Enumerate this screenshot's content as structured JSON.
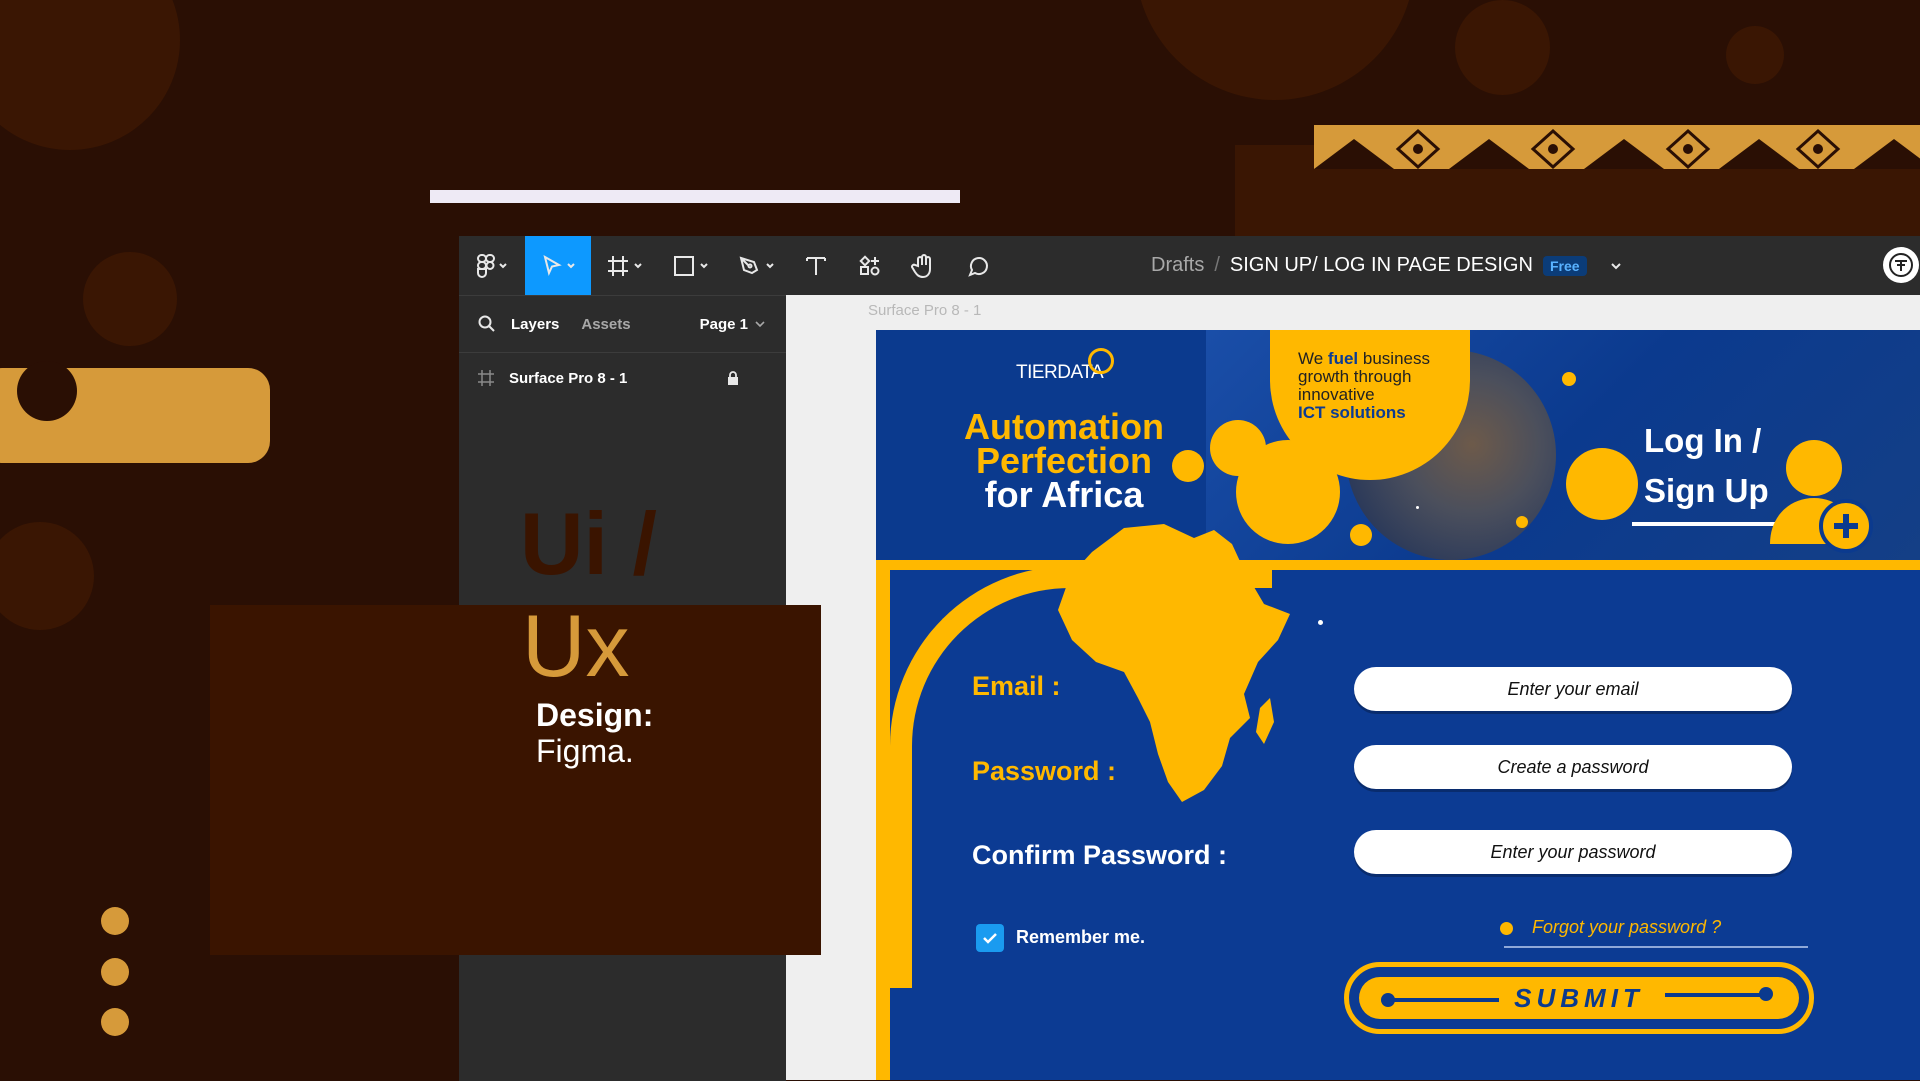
{
  "overlay": {
    "title_line1": "Ui /",
    "title_line2": "Ux",
    "design_label": "Design:",
    "design_tool": "Figma."
  },
  "toolbar": {
    "breadcrumb_drafts": "Drafts",
    "breadcrumb_sep": "/",
    "file_name": "SIGN UP/ LOG IN PAGE DESIGN",
    "plan_badge": "Free"
  },
  "layers_panel": {
    "tab_layers": "Layers",
    "tab_assets": "Assets",
    "page_selector": "Page 1",
    "layer_name": "Surface Pro 8 - 1"
  },
  "canvas": {
    "frame_label": "Surface Pro 8 - 1"
  },
  "design": {
    "brand": "TIERDATA",
    "headline_line1": "Automation",
    "headline_line2": "Perfection",
    "headline_line3": "for Africa",
    "bubble_line1": "We ",
    "bubble_fuel": "fuel",
    "bubble_line1b": " business",
    "bubble_line2": "growth through",
    "bubble_line3": "innovative",
    "bubble_line4": "ICT solutions",
    "login_title_line1": "Log In /",
    "login_title_line2": "Sign Up",
    "email_label": "Email :",
    "password_label": "Password :",
    "confirm_label": "Confirm Password :",
    "email_placeholder": "Enter your email",
    "password_placeholder": "Create a password",
    "confirm_placeholder": "Enter your password",
    "remember_label": "Remember me.",
    "remember_checked": true,
    "forgot_link": "Forgot your password ?",
    "submit_label": "SUBMIT"
  },
  "colors": {
    "background": "#2a0f04",
    "accent_gold": "#d69a3a",
    "figma_blue": "#0d99ff",
    "design_blue": "#0c3b93",
    "design_yellow": "#ffb800"
  },
  "icons": [
    "figma-menu-icon",
    "move-tool-icon",
    "frame-tool-icon",
    "shape-tool-icon",
    "pen-tool-icon",
    "text-tool-icon",
    "resources-icon",
    "hand-tool-icon",
    "comment-icon",
    "search-icon",
    "frame-layer-icon",
    "lock-icon",
    "avatar-icon",
    "africa-map-icon",
    "user-add-icon",
    "checkbox-icon"
  ]
}
